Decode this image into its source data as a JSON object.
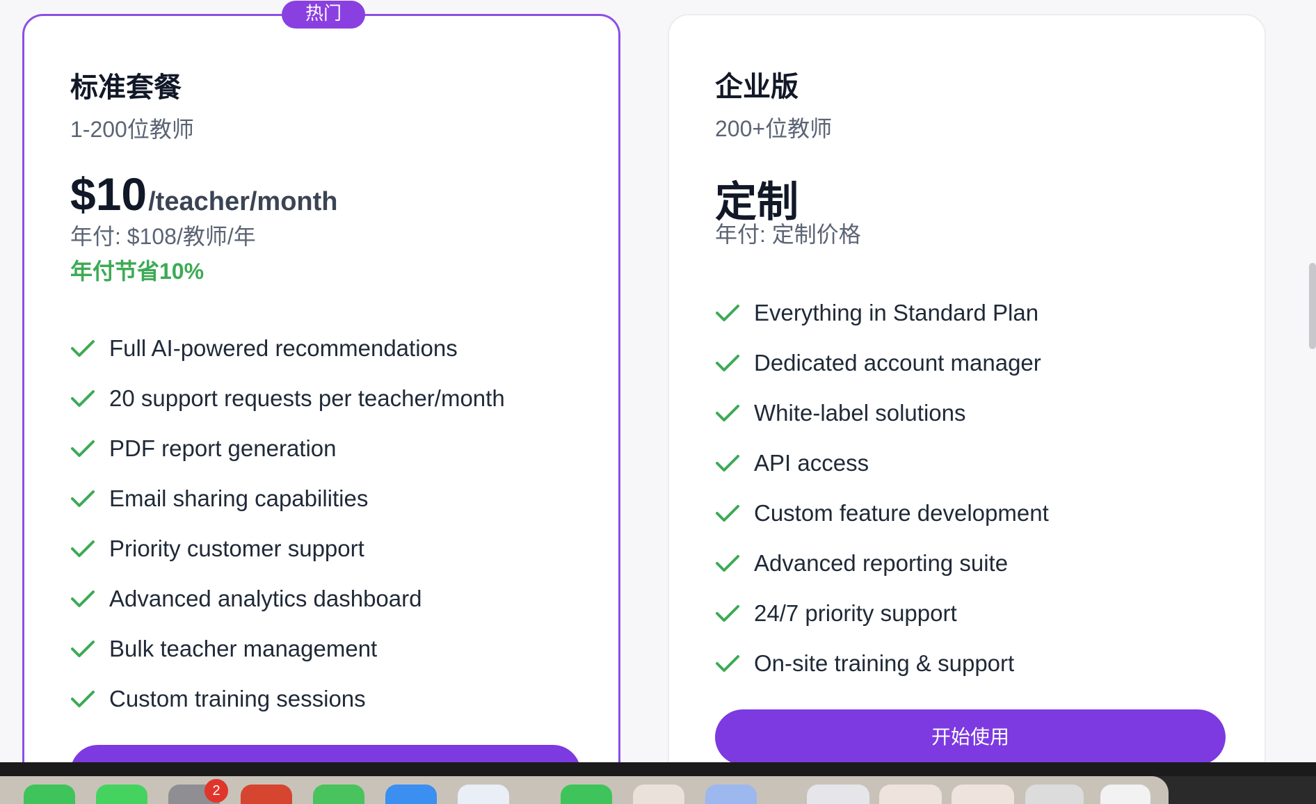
{
  "standard": {
    "badge": "热门",
    "name": "标准套餐",
    "subtitle": "1-200位教师",
    "price": "$10",
    "price_unit": "/teacher/month",
    "yearly": "年付: $108/教师/年",
    "savings": "年付节省10%",
    "features": [
      "Full AI-powered recommendations",
      "20 support requests per teacher/month",
      "PDF report generation",
      "Email sharing capabilities",
      "Priority customer support",
      "Advanced analytics dashboard",
      "Bulk teacher management",
      "Custom training sessions"
    ]
  },
  "enterprise": {
    "name": "企业版",
    "subtitle": "200+位教师",
    "price": "定制",
    "yearly": "年付: 定制价格",
    "features": [
      "Everything in Standard Plan",
      "Dedicated account manager",
      "White-label solutions",
      "API access",
      "Custom feature development",
      "Advanced reporting suite",
      "24/7 priority support",
      "On-site training & support"
    ],
    "cta": "开始使用"
  },
  "dock": {
    "notification_count": "2"
  },
  "colors": {
    "accent": "#7c3ae0",
    "highlight_border": "#8b4fe6",
    "check": "#3daa55"
  }
}
